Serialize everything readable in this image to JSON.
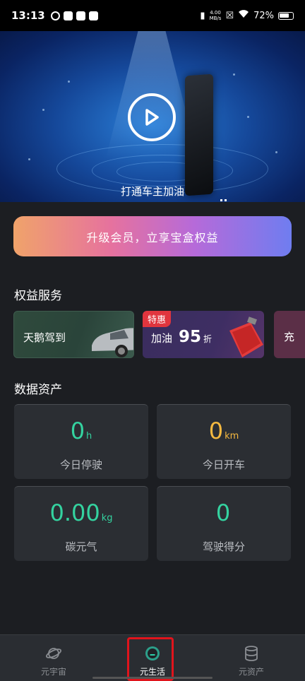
{
  "status_bar": {
    "time": "13:13",
    "net_speed_value": "4.00",
    "net_speed_unit": "MB/s",
    "battery": "72%"
  },
  "banner": {
    "caption": "打通车主加油"
  },
  "upgrade_button": {
    "label": "升级会员，立享宝盒权益"
  },
  "benefits": {
    "title": "权益服务",
    "items": [
      {
        "label": "天鹅驾到"
      },
      {
        "tag": "特惠",
        "label": "加油",
        "number": "95",
        "unit": "折"
      },
      {
        "label": "充"
      }
    ]
  },
  "data_assets": {
    "title": "数据资产",
    "cards": [
      {
        "value": "0",
        "unit": "h",
        "label": "今日停驶",
        "color": "#34d3a0"
      },
      {
        "value": "0",
        "unit": "km",
        "label": "今日开车",
        "color": "#f5b940"
      },
      {
        "value": "0.00",
        "unit": "kg",
        "label": "碳元气",
        "color": "#34d3a0"
      },
      {
        "value": "0",
        "unit": "",
        "label": "驾驶得分",
        "color": "#34d3a0"
      }
    ]
  },
  "bottom_nav": {
    "items": [
      {
        "label": "元宇宙",
        "icon": "planet-icon"
      },
      {
        "label": "元生活",
        "icon": "gauge-icon"
      },
      {
        "label": "元资产",
        "icon": "database-icon"
      }
    ],
    "active": "元生活"
  }
}
